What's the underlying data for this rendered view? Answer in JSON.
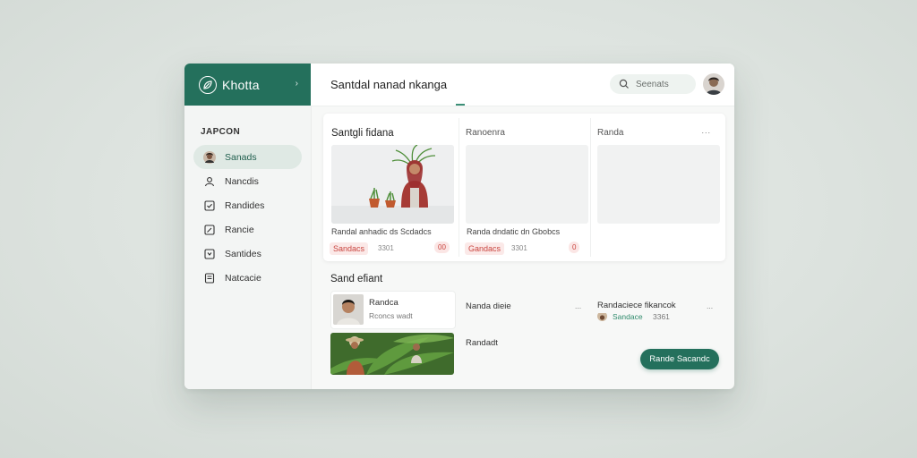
{
  "app": {
    "brand": "Khotta",
    "page_title": "Santdal nanad nkanga"
  },
  "search": {
    "placeholder": "Seenats"
  },
  "sidebar": {
    "heading": "JAPCON",
    "items": [
      {
        "label": "Sanads",
        "icon": "avatar-icon"
      },
      {
        "label": "Nancdis",
        "icon": "user-icon"
      },
      {
        "label": "Randides",
        "icon": "checkbox-icon"
      },
      {
        "label": "Rancie",
        "icon": "edit-icon"
      },
      {
        "label": "Santides",
        "icon": "check-icon"
      },
      {
        "label": "Natcacie",
        "icon": "document-icon"
      }
    ]
  },
  "cards": {
    "columns": [
      {
        "heading": "Santgli fidana"
      },
      {
        "heading": "Ranoenra"
      },
      {
        "heading": "Randa"
      }
    ],
    "more": "...",
    "items": [
      {
        "caption": "Randal anhadic ds Scdadcs",
        "tag": "Sandacs",
        "meta": "3301",
        "pill": "00"
      },
      {
        "caption": "Randa dndatic dn Gbobcs",
        "tag": "Gandacs",
        "meta": "3301",
        "pill": "0"
      }
    ]
  },
  "section": {
    "title": "Sand efiant",
    "rows": [
      {
        "title": "Randca",
        "sub": "Rconcs wadt"
      },
      {
        "title": "Nanda dieie",
        "more": "..."
      },
      {
        "title": "Randaciece fikancok",
        "sub_tag": "Sandace",
        "sub_meta": "3361",
        "more": "..."
      },
      {
        "title": "Randadt"
      }
    ],
    "cta": "Rande Sacandc"
  },
  "colors": {
    "brand": "#24705c",
    "accent_red": "#c9453f",
    "accent_green": "#2e8a6b"
  }
}
